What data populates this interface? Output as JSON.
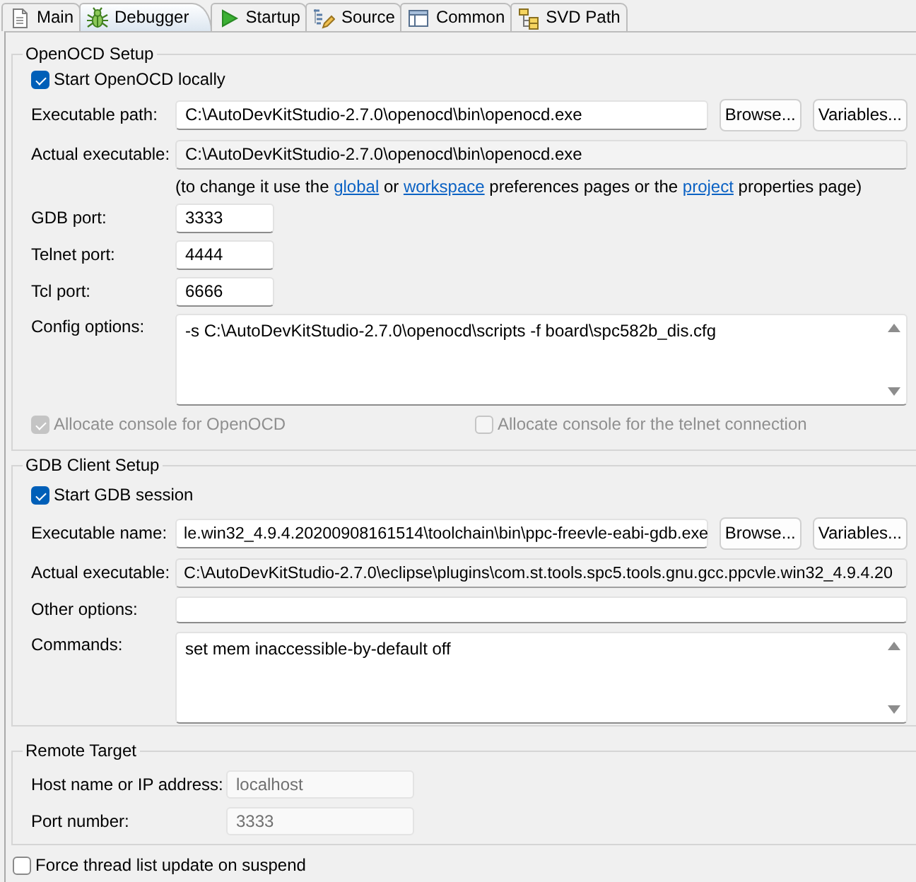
{
  "tabs": [
    {
      "label": "Main",
      "selected": false
    },
    {
      "label": "Debugger",
      "selected": true
    },
    {
      "label": "Startup",
      "selected": false
    },
    {
      "label": "Source",
      "selected": false
    },
    {
      "label": "Common",
      "selected": false
    },
    {
      "label": "SVD Path",
      "selected": false
    }
  ],
  "openocd_setup": {
    "title": "OpenOCD Setup",
    "start_locally": {
      "label": "Start OpenOCD locally",
      "checked": true
    },
    "executable_path": {
      "label": "Executable path:",
      "value": "C:\\AutoDevKitStudio-2.7.0\\openocd\\bin\\openocd.exe",
      "buttons": [
        "Browse...",
        "Variables..."
      ]
    },
    "actual_executable": {
      "label": "Actual executable:",
      "value": "C:\\AutoDevKitStudio-2.7.0\\openocd\\bin\\openocd.exe",
      "readonly": true
    },
    "note": [
      {
        "kind": "text",
        "text": "(to change it use the "
      },
      {
        "kind": "link",
        "text": "global"
      },
      {
        "kind": "text",
        "text": " or "
      },
      {
        "kind": "link",
        "text": "workspace"
      },
      {
        "kind": "text",
        "text": " preferences pages or the "
      },
      {
        "kind": "link",
        "text": "project"
      },
      {
        "kind": "text",
        "text": " properties page)"
      }
    ],
    "ports": [
      {
        "label": "GDB port:",
        "value": "3333"
      },
      {
        "label": "Telnet port:",
        "value": "4444"
      },
      {
        "label": "Tcl port:",
        "value": "6666"
      }
    ],
    "config_options": {
      "label": "Config options:",
      "value": "-s C:\\AutoDevKitStudio-2.7.0\\openocd\\scripts -f board\\spc582b_dis.cfg"
    },
    "allocate_consoles": [
      {
        "label": "Allocate console for OpenOCD",
        "checked": true,
        "disabled": true
      },
      {
        "label": "Allocate console for the telnet connection",
        "checked": false,
        "disabled": true
      }
    ]
  },
  "gdb_client_setup": {
    "title": "GDB Client Setup",
    "start_session": {
      "label": "Start GDB session",
      "checked": true
    },
    "executable_name": {
      "label": "Executable name:",
      "value": "le.win32_4.9.4.20200908161514\\toolchain\\bin\\ppc-freevle-eabi-gdb.exe",
      "buttons": [
        "Browse...",
        "Variables..."
      ]
    },
    "actual_executable": {
      "label": "Actual executable:",
      "value": "C:\\AutoDevKitStudio-2.7.0\\eclipse\\plugins\\com.st.tools.spc5.tools.gnu.gcc.ppcvle.win32_4.9.4.20",
      "readonly": true
    },
    "other_options": {
      "label": "Other options:"
    },
    "commands": {
      "label": "Commands:",
      "value": "set mem inaccessible-by-default off"
    }
  },
  "remote_target": {
    "title": "Remote Target",
    "host": {
      "label": "Host name or IP address:",
      "value": "localhost",
      "disabled": true
    },
    "port": {
      "label": "Port number:",
      "value": "3333",
      "disabled": true
    }
  },
  "force_thread_update": {
    "label": "Force thread list update on suspend",
    "checked": false
  }
}
